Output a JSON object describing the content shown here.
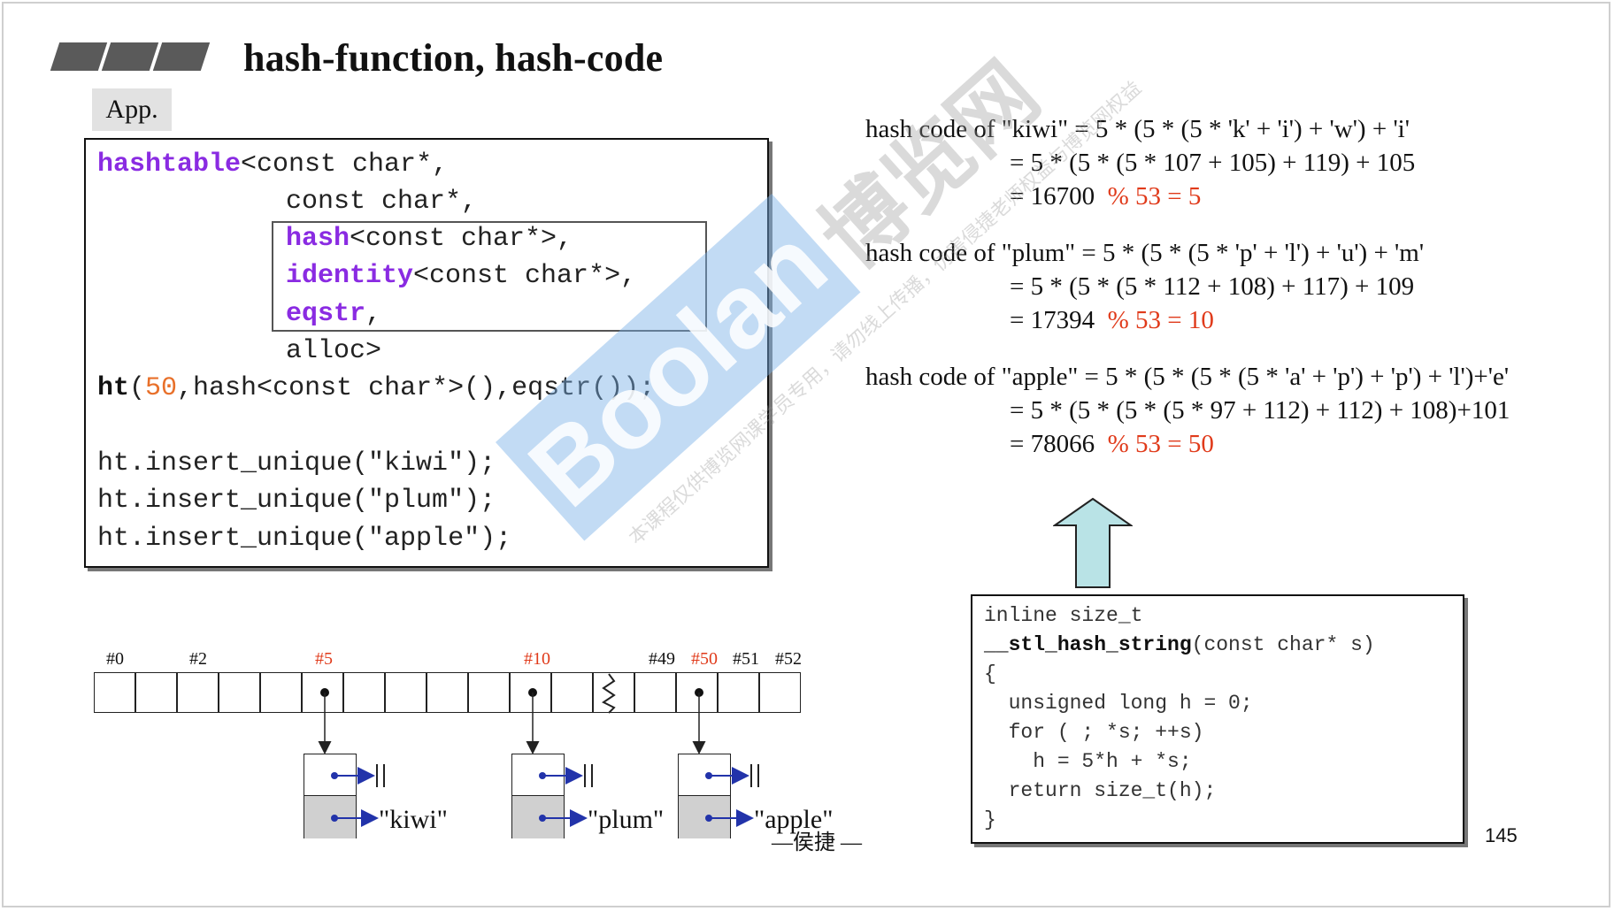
{
  "slide": {
    "title": "hash-function, hash-code",
    "app_tag": "App.",
    "page_number": "145",
    "author": "—侯捷 —"
  },
  "code": {
    "l1_kw": "hashtable",
    "l1_rest": "<const char*,",
    "l2": "const char*,",
    "l3_kw": "hash",
    "l3_rest": "<const char*>,",
    "l4_kw": "identity",
    "l4_rest": "<const char*>,",
    "l5_kw": "eqstr",
    "l5_rest": ",",
    "l6": "alloc>",
    "l7_kw": "ht",
    "l7_open": "(",
    "l7_num": "50",
    "l7_rest": ",hash<const char*>(),eqstr());",
    "l8": "ht.insert_unique(\"kiwi\");",
    "l9": "ht.insert_unique(\"plum\");",
    "l10": "ht.insert_unique(\"apple\");"
  },
  "math": {
    "kiwi_l1": "hash code of \"kiwi\" = 5 * (5 * (5 * 'k' + 'i') + 'w') + 'i'",
    "kiwi_l2": "= 5 * (5 * (5 * 107 + 105) + 119) + 105",
    "kiwi_l3": "= 16700",
    "kiwi_mod": "% 53 = 5",
    "plum_l1": "hash code of \"plum\" = 5 * (5 * (5 * 'p' + 'l') + 'u') + 'm'",
    "plum_l2": "= 5 * (5 * (5 * 112 + 108) + 117) + 109",
    "plum_l3": "=  17394",
    "plum_mod": "% 53 = 10",
    "apple_l1": "hash code of \"apple\" = 5 * (5 * (5 * (5 * 'a' + 'p') + 'p') + 'l')+'e'",
    "apple_l2": "= 5 * (5 * (5 * (5 * 97 + 112) + 112) + 108)+101",
    "apple_l3": "=  78066",
    "apple_mod": "% 53 = 50"
  },
  "table": {
    "labels": [
      "#0",
      "#2",
      "#5",
      "#10",
      "#49",
      "#50",
      "#51",
      "#52"
    ],
    "nodes": [
      "\"kiwi\"",
      "\"plum\"",
      "\"apple\""
    ]
  },
  "stl_code": {
    "l1": "inline size_t",
    "l2_fn": "__stl_hash_string",
    "l2_rest": "(const char* s)",
    "l3": "{",
    "l4": "  unsigned long h = 0;",
    "l5": "  for ( ; *s; ++s)",
    "l6": "    h = 5*h + *s;",
    "l7": "  return size_t(h);",
    "l8": "}"
  },
  "watermark": {
    "brand": "Boolan",
    "cn": "博览网",
    "note": "本课程仅供博览网课学员专用，请勿线上传播，仿害侵捷老师权益与博览网权益"
  },
  "colors": {
    "keyword": "#8a2be2",
    "number": "#e8702a",
    "modulo": "#e03a1a",
    "arrow_fill": "#b9e3e6"
  }
}
